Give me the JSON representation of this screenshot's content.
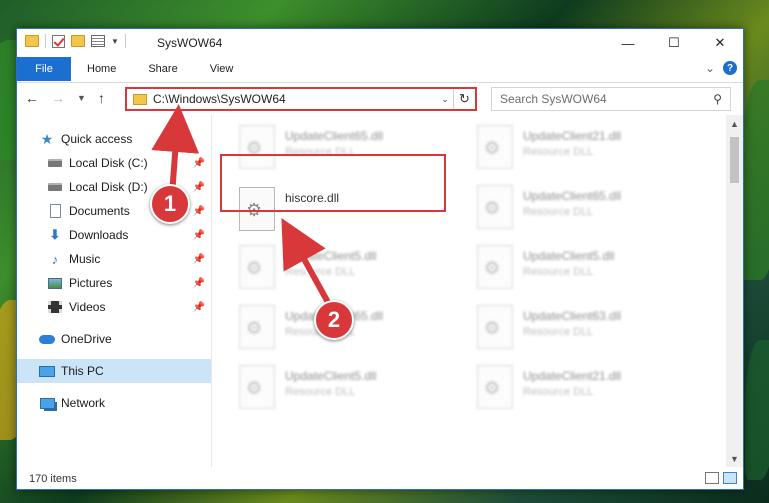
{
  "window": {
    "title": "SysWOW64",
    "controls": {
      "minimize": "—",
      "maximize": "☐",
      "close": "✕"
    }
  },
  "ribbon": {
    "file_tab": "File",
    "tabs": [
      "Home",
      "Share",
      "View"
    ]
  },
  "address": {
    "path": "C:\\Windows\\SysWOW64",
    "search_placeholder": "Search SysWOW64"
  },
  "sidebar": {
    "items": [
      {
        "label": "Quick access",
        "icon": "star-icon"
      },
      {
        "label": "Local Disk (C:)",
        "icon": "disk-icon"
      },
      {
        "label": "Local Disk (D:)",
        "icon": "disk-icon"
      },
      {
        "label": "Documents",
        "icon": "documents-icon"
      },
      {
        "label": "Downloads",
        "icon": "downloads-icon"
      },
      {
        "label": "Music",
        "icon": "music-icon"
      },
      {
        "label": "Pictures",
        "icon": "pictures-icon"
      },
      {
        "label": "Videos",
        "icon": "videos-icon"
      },
      {
        "label": "OneDrive",
        "icon": "onedrive-icon"
      },
      {
        "label": "This PC",
        "icon": "this-pc-icon",
        "selected": true
      },
      {
        "label": "Network",
        "icon": "network-icon"
      }
    ]
  },
  "files": {
    "col1": [
      {
        "name": "UpdateClient65.dll",
        "type": "Resource DLL"
      },
      {
        "name": "hiscore.dll",
        "type": ""
      },
      {
        "name": "UpdateClient5.dll",
        "type": "Resource DLL"
      },
      {
        "name": "UpdateClient65.dll",
        "type": "Resource DLL"
      },
      {
        "name": "UpdateClient5.dll",
        "type": "Resource DLL"
      }
    ],
    "col2": [
      {
        "name": "UpdateClient21.dll",
        "type": "Resource DLL"
      },
      {
        "name": "UpdateClient65.dll",
        "type": "Resource DLL"
      },
      {
        "name": "UpdateClient5.dll",
        "type": "Resource DLL"
      },
      {
        "name": "UpdateClient63.dll",
        "type": "Resource DLL"
      },
      {
        "name": "UpdateClient21.dll",
        "type": "Resource DLL"
      }
    ]
  },
  "status": {
    "item_count": "170 items"
  },
  "annotations": {
    "step1": "1",
    "step2": "2",
    "color": "#d9383a"
  }
}
